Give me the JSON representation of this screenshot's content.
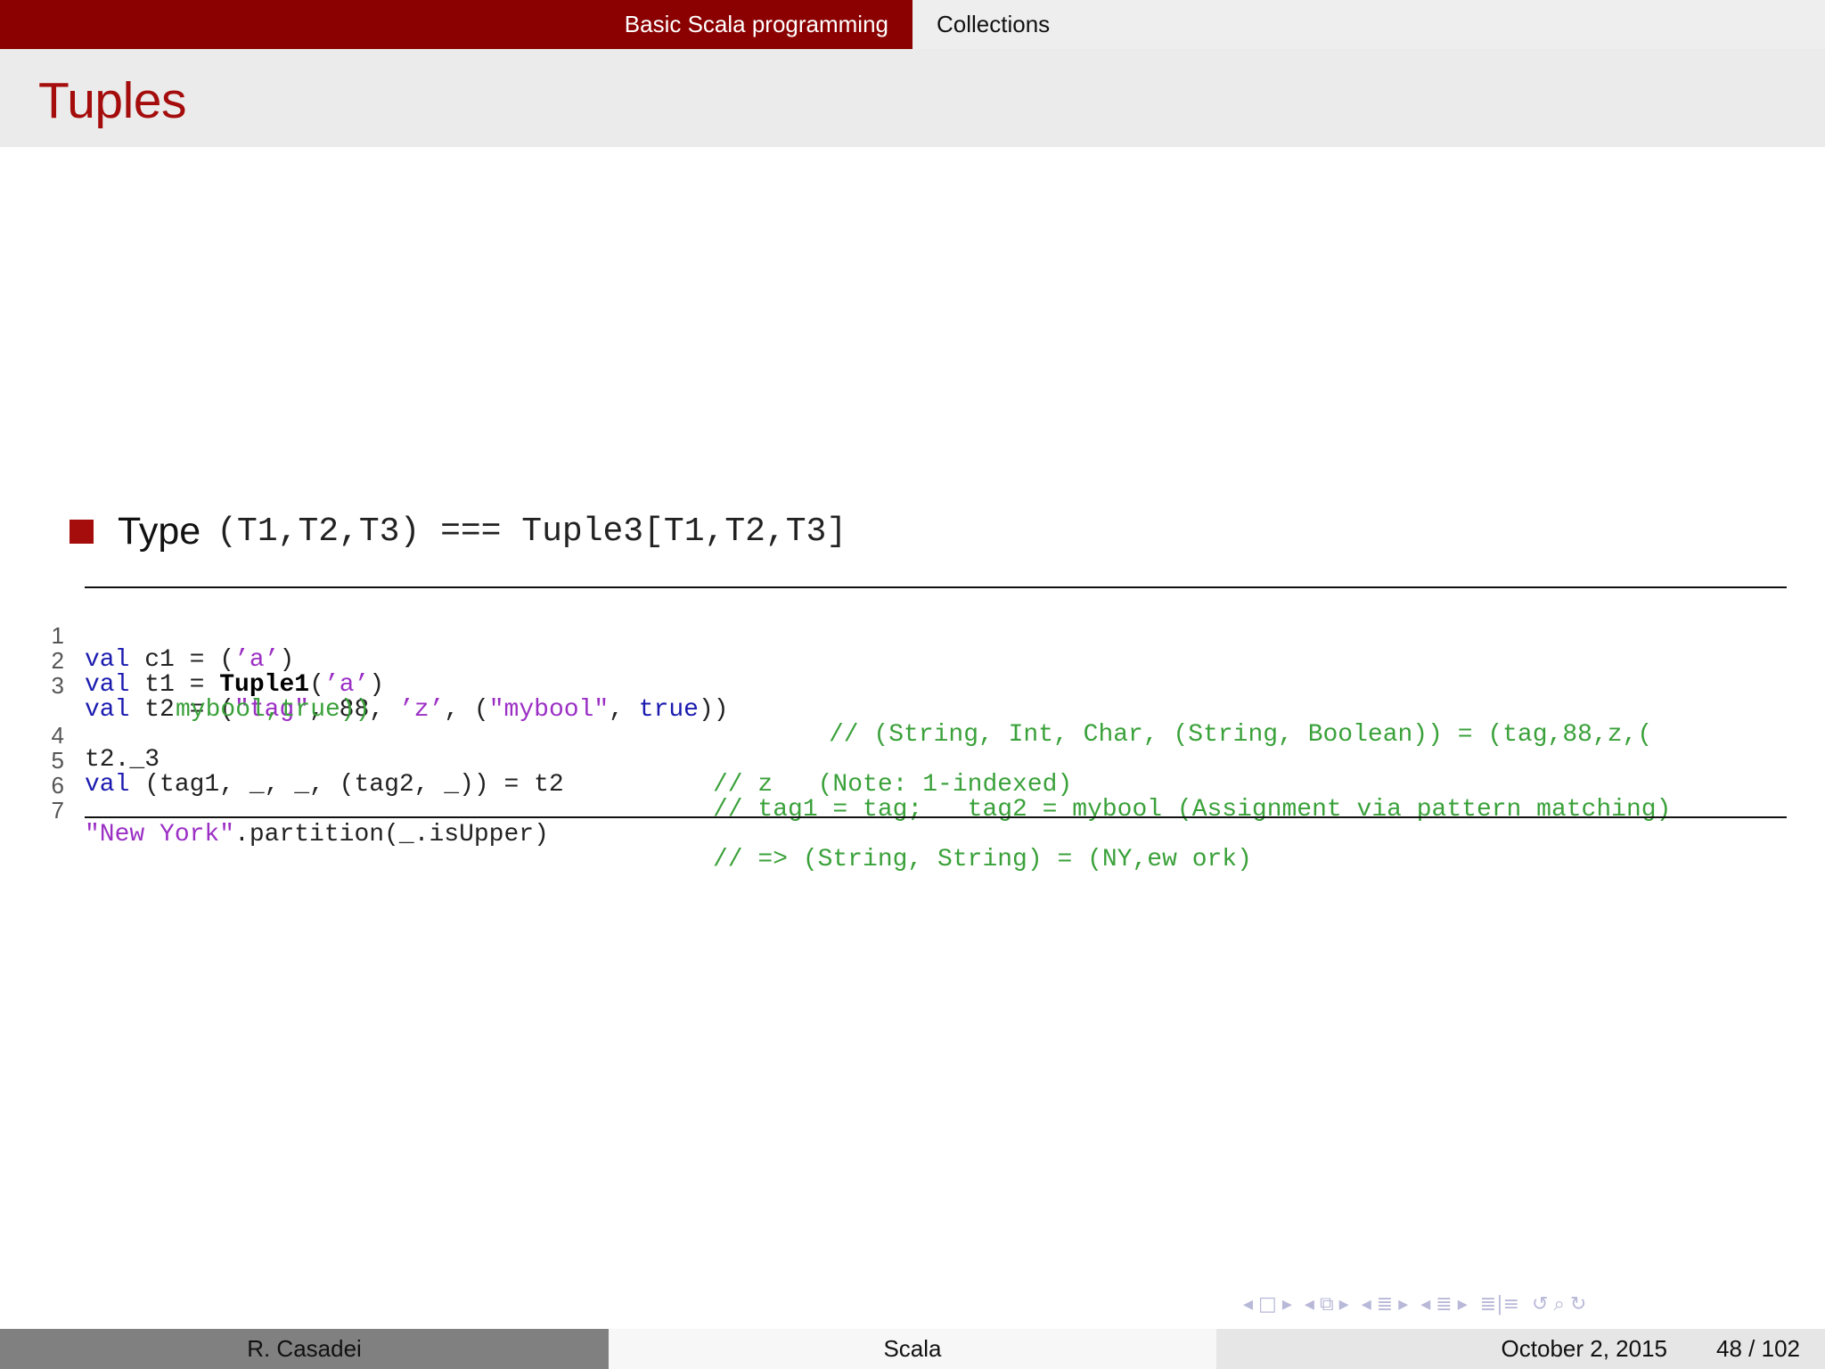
{
  "header": {
    "section": "Basic Scala programming",
    "subsection": "Collections"
  },
  "frame": {
    "title": "Tuples"
  },
  "bullet": {
    "label": "Type",
    "code": "(T1,T2,T3) === Tuple3[T1,T2,T3]"
  },
  "listing": {
    "lines": [
      {
        "num": "1",
        "code_parts": [
          "val",
          " c1 = (",
          "’a’",
          ")"
        ],
        "comment": ""
      },
      {
        "num": "2",
        "code_parts": [
          "val",
          " t1 = ",
          "Tuple1",
          "(",
          "’a’",
          ")"
        ],
        "comment": ""
      },
      {
        "num": "3",
        "code_parts": [
          "val",
          " t2 = (",
          "\"tag\"",
          ", 88, ",
          "’z’",
          ", (",
          "\"mybool\"",
          ", ",
          "true",
          "))"
        ],
        "comment": "// (String, Int, Char, (String, Boolean)) = (tag,88,z,("
      },
      {
        "num": "",
        "code_parts": [],
        "comment": "mybool,true))"
      },
      {
        "num": "4",
        "code_parts": [
          "t2._3"
        ],
        "comment": "// z   (Note: 1-indexed)"
      },
      {
        "num": "5",
        "code_parts": [
          "val",
          " (tag1, _, _, (tag2, _)) = t2"
        ],
        "comment": "// tag1 = tag;   tag2 = mybool (Assignment via pattern matching)"
      },
      {
        "num": "6",
        "code_parts": [],
        "comment": ""
      },
      {
        "num": "7",
        "code_parts": [
          "\"New York\"",
          ".partition(_.isUpper)"
        ],
        "comment": "// => (String, String) = (NY,ew ork)"
      }
    ]
  },
  "footer": {
    "author": "R. Casadei",
    "short_title": "Scala",
    "date": "October 2, 2015",
    "page": "48 / 102"
  },
  "colors": {
    "accent": "#8b0000",
    "title": "#a50d0d",
    "keyword": "#1b1bb0",
    "string": "#9b2fc4",
    "comment": "#3aa13a"
  }
}
